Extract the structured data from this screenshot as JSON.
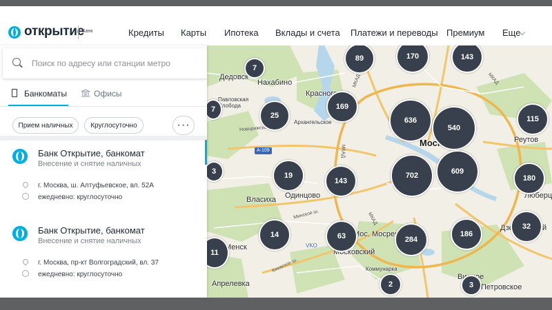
{
  "header": {
    "logo_text": "открытие",
    "logo_sub": "Банк",
    "nav": [
      "Кредиты",
      "Карты",
      "Ипотека",
      "Вклады и счета",
      "Платежи и переводы",
      "Премиум",
      "Еще"
    ]
  },
  "search": {
    "placeholder": "Поиск по адресу или станции метро"
  },
  "tabs": {
    "atms": "Банкоматы",
    "offices": "Офисы"
  },
  "filters": {
    "cash": "Прием наличных",
    "allday": "Круглосуточно",
    "more": "···"
  },
  "results": [
    {
      "title": "Банк Открытие, банкомат",
      "subtitle": "Внесение и снятие наличных",
      "address": "г. Москва, ш. Алтуфьевское, вл. 52А",
      "hours": "ежедневно: круглосуточно"
    },
    {
      "title": "Банк Открытие, банкомат",
      "subtitle": "Внесение и снятие наличных",
      "address": "г. Москва, пр-кт Волгоградский, вл. 37",
      "hours": "ежедневно: круглосуточно"
    }
  ],
  "map": {
    "clusters": [
      "89",
      "170",
      "143",
      "7",
      "169",
      "25",
      "636",
      "540",
      "115",
      "7",
      "19",
      "143",
      "702",
      "609",
      "180",
      "3",
      "14",
      "63",
      "284",
      "186",
      "32",
      "11",
      "2",
      "3"
    ],
    "places": [
      "Дедовск",
      "Нахабино",
      "Красногорск",
      "Москва",
      "Реутов",
      "Павловская Слобода",
      "Архангельское",
      "Власиха",
      "Одинцово",
      "Московский",
      "Мос. Мосрентген",
      "Коммунарка",
      "Апрелевка",
      "Люберцы",
      "Дзержинский",
      "Петровское",
      "Видное",
      "Менск"
    ],
    "roads": [
      "А-109",
      "МКАД",
      "МКАД",
      "МКАД",
      "МКАД",
      "Минское ш.",
      "Киевское ш.",
      "Новорижское ш."
    ],
    "airport": "VKO",
    "colors": {
      "cluster": "#37404c",
      "water": "#b6d6ec",
      "forest": "#cfe2b4",
      "road": "#f3c56a"
    }
  }
}
